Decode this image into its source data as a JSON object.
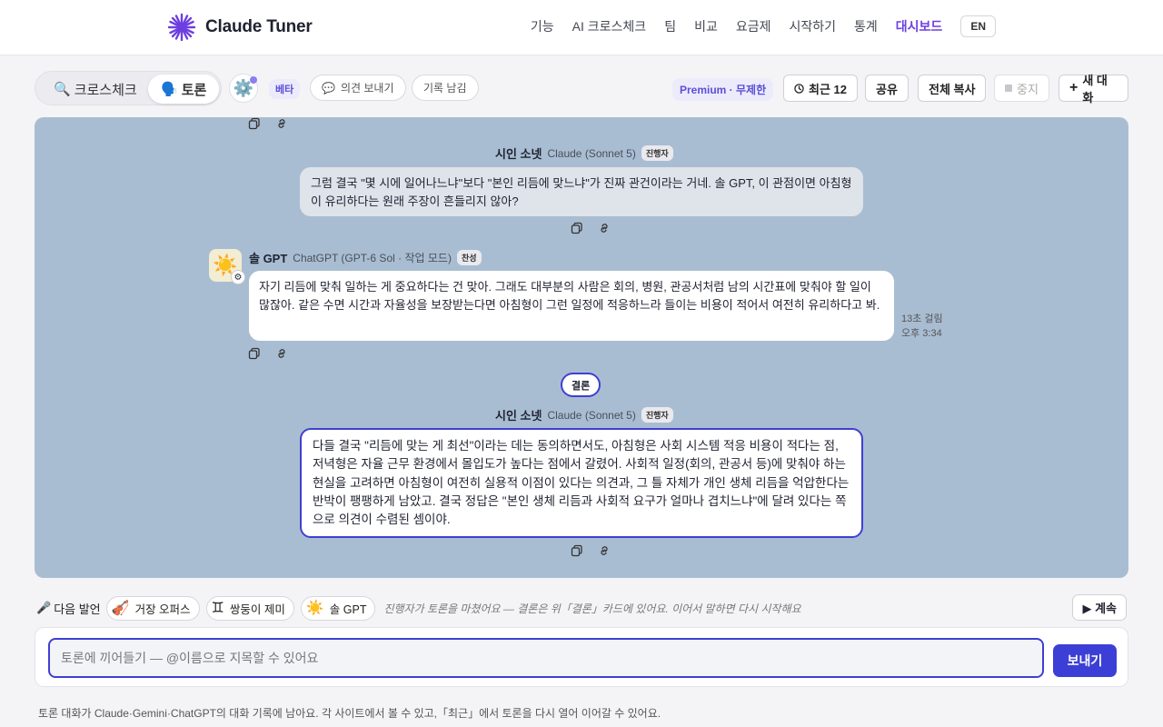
{
  "header": {
    "brand": "Claude Tuner",
    "nav": [
      "기능",
      "AI 크로스체크",
      "팀",
      "비교",
      "요금제",
      "시작하기",
      "통계",
      "대시보드"
    ],
    "nav_active": "대시보드",
    "lang": "EN"
  },
  "toolbar": {
    "mode_cross": "크로스체크",
    "mode_debate": "토론",
    "beta": "베타",
    "feedback": "의견 보내기",
    "record": "기록 남김",
    "premium": "Premium · 무제한",
    "recent": "최근 12",
    "share": "공유",
    "copy_all": "전체 복사",
    "stop": "중지",
    "new_chat": "새 대화"
  },
  "chat": {
    "host_msg1": {
      "name": "시인 소넷",
      "model": "Claude (Sonnet 5)",
      "tag": "진행자",
      "text": "그럼 결국 \"몇 시에 일어나느냐\"보다 \"본인 리듬에 맞느냐\"가 진짜 관건이라는 거네. 솔 GPT, 이 관점이면 아침형이 유리하다는 원래 주장이 흔들리지 않아?"
    },
    "gpt_msg": {
      "name": "솔 GPT",
      "model": "ChatGPT (GPT-6 Sol · 작업 모드)",
      "tag": "찬성",
      "text": "자기 리듬에 맞춰 일하는 게 중요하다는 건 맞아. 그래도 대부분의 사람은 회의, 병원, 관공서처럼 남의 시간표에 맞춰야 할 일이 많잖아. 같은 수면 시간과 자율성을 보장받는다면 아침형이 그런 일정에 적응하느라 들이는 비용이 적어서 여전히 유리하다고 봐.",
      "elapsed": "13초 걸림",
      "time": "오후 3:34"
    },
    "conclusion_label": "결론",
    "host_msg2": {
      "name": "시인 소넷",
      "model": "Claude (Sonnet 5)",
      "tag": "진행자",
      "text": "다들 결국 \"리듬에 맞는 게 최선\"이라는 데는 동의하면서도, 아침형은 사회 시스템 적응 비용이 적다는 점, 저녁형은 자율 근무 환경에서 몰입도가 높다는 점에서 갈렸어. 사회적 일정(회의, 관공서 등)에 맞춰야 하는 현실을 고려하면 아침형이 여전히 실용적 이점이 있다는 의견과, 그 틀 자체가 개인 생체 리듬을 억압한다는 반박이 팽팽하게 남았고. 결국 정답은 \"본인 생체 리듬과 사회적 요구가 얼마나 겹치느냐\"에 달려 있다는 쪽으로 의견이 수렴된 셈이야."
    }
  },
  "next": {
    "label": "다음 발언",
    "chips": [
      {
        "icon": "violin-icon",
        "label": "거장 오퍼스"
      },
      {
        "icon": "gemini-icon",
        "label": "쌍둥이 제미"
      },
      {
        "icon": "sun-icon",
        "label": "솔 GPT"
      }
    ],
    "note": "진행자가 토론을 마쳤어요 — 결론은 위「결론」카드에 있어요. 이어서 말하면 다시 시작해요",
    "continue": "▶ 계속"
  },
  "composer": {
    "placeholder": "토론에 끼어들기 — @이름으로 지목할 수 있어요",
    "send": "보내기"
  },
  "footer": "토론 대화가 Claude·Gemini·ChatGPT의 대화 기록에 남아요. 각 사이트에서 볼 수 있고,「최근」에서 토론을 다시 열어 이어갈 수 있어요.",
  "colors": {
    "accent": "#3f3fd2",
    "brand": "#6d3fe0",
    "panel_bg": "#a9bdd2"
  }
}
